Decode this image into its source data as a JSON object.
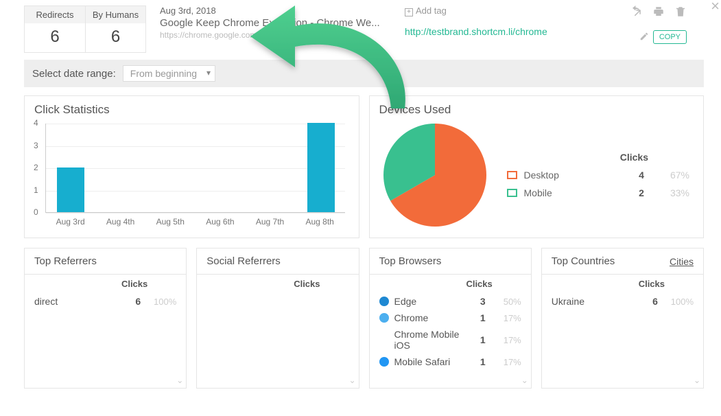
{
  "header": {
    "redirects_label": "Redirects",
    "redirects_value": "6",
    "byhumans_label": "By Humans",
    "byhumans_value": "6",
    "date": "Aug 3rd, 2018",
    "page_title": "Google Keep Chrome Extension - Chrome We...",
    "long_url": "https://chrome.google.com/webstore/detail/google-keep...",
    "add_tag": "Add tag",
    "short_link": "http://testbrand.shortcm.li/chrome",
    "copy": "COPY"
  },
  "range": {
    "label": "Select date range:",
    "selected": "From beginning"
  },
  "panels": {
    "click_stats": "Click Statistics",
    "devices": "Devices Used",
    "top_referrers": "Top Referrers",
    "social_referrers": "Social Referrers",
    "top_browsers": "Top Browsers",
    "top_countries": "Top Countries",
    "cities_link": "Cities",
    "clicks_hdr": "Clicks"
  },
  "devices": {
    "rows": [
      {
        "name": "Desktop",
        "clicks": "4",
        "pct": "67%",
        "color": "#f26b3a"
      },
      {
        "name": "Mobile",
        "clicks": "2",
        "pct": "33%",
        "color": "#39c08f"
      }
    ]
  },
  "referrers": {
    "rows": [
      {
        "name": "direct",
        "clicks": "6",
        "pct": "100%"
      }
    ]
  },
  "browsers": {
    "rows": [
      {
        "name": "Edge",
        "clicks": "3",
        "pct": "50%",
        "color": "#1e88d2"
      },
      {
        "name": "Chrome",
        "clicks": "1",
        "pct": "17%",
        "color": "#4cafef"
      },
      {
        "name": "Chrome Mobile iOS",
        "clicks": "1",
        "pct": "17%",
        "color": ""
      },
      {
        "name": "Mobile Safari",
        "clicks": "1",
        "pct": "17%",
        "color": "#2196f3"
      }
    ]
  },
  "countries": {
    "rows": [
      {
        "name": "Ukraine",
        "clicks": "6",
        "pct": "100%"
      }
    ]
  },
  "chart_data": {
    "type": "bar",
    "categories": [
      "Aug 3rd",
      "Aug 4th",
      "Aug 5th",
      "Aug 6th",
      "Aug 7th",
      "Aug 8th"
    ],
    "values": [
      2,
      0,
      0,
      0,
      0,
      4
    ],
    "title": "Click Statistics",
    "xlabel": "",
    "ylabel": "",
    "ylim": [
      0,
      4
    ],
    "yticks": [
      0,
      1,
      2,
      3,
      4
    ]
  },
  "pie_data": {
    "type": "pie",
    "series": [
      {
        "name": "Desktop",
        "value": 4,
        "pct": 67,
        "color": "#f26b3a"
      },
      {
        "name": "Mobile",
        "value": 2,
        "pct": 33,
        "color": "#39c08f"
      }
    ]
  }
}
